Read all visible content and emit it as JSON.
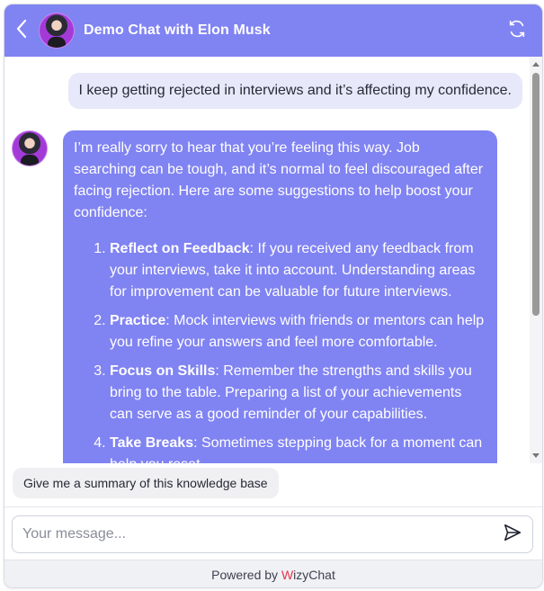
{
  "header": {
    "title": "Demo Chat with Elon Musk",
    "back_icon": "chevron-left-icon",
    "refresh_icon": "refresh-icon",
    "background": "#8083f2"
  },
  "messages": {
    "user": {
      "text": "I keep getting rejected in interviews and it’s affecting my confidence."
    },
    "bot": {
      "intro": "I’m really sorry to hear that you’re feeling this way. Job searching can be tough, and it’s normal to feel discouraged after facing rejection. Here are some suggestions to help boost your confidence:",
      "items": [
        {
          "title": "Reflect on Feedback",
          "body": ": If you received any feedback from your interviews, take it into account. Understanding areas for improvement can be valuable for future interviews."
        },
        {
          "title": "Practice",
          "body": ": Mock interviews with friends or mentors can help you refine your answers and feel more comfortable."
        },
        {
          "title": "Focus on Skills",
          "body": ": Remember the strengths and skills you bring to the table. Preparing a list of your achievements can serve as a good reminder of your capabilities."
        },
        {
          "title": "Take Breaks",
          "body": ": Sometimes stepping back for a moment can help you reset."
        }
      ]
    }
  },
  "suggestion": {
    "label": "Give me a summary of this knowledge base"
  },
  "composer": {
    "placeholder": "Your message...",
    "value": "",
    "send_icon": "send-icon"
  },
  "footer": {
    "prefix": "Powered by ",
    "brand_first": "W",
    "brand_rest": "izyChat",
    "brand_color": "#e3334b"
  }
}
